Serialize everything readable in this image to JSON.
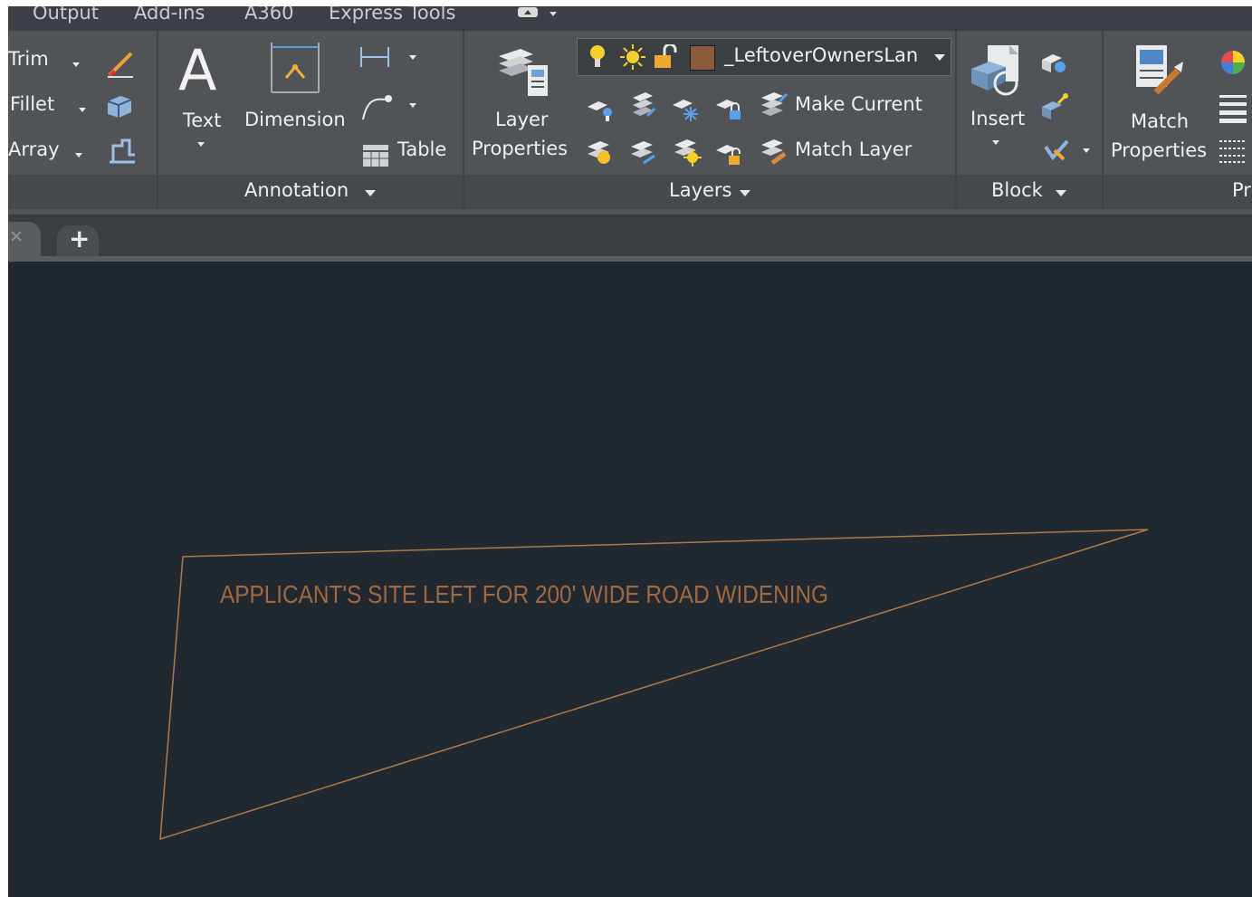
{
  "menu": {
    "tabs": [
      "Output",
      "Add-ins",
      "A360",
      "Express Tools"
    ]
  },
  "modify": {
    "trim": "Trim",
    "fillet": "Fillet",
    "array": "Array"
  },
  "annotation": {
    "text": "Text",
    "dimension": "Dimension",
    "table": "Table",
    "panel_title": "Annotation"
  },
  "layers": {
    "layer_properties_line1": "Layer",
    "layer_properties_line2": "Properties",
    "current_layer": "_LeftoverOwnersLan",
    "layer_color": "#8a5a3c",
    "make_current": "Make Current",
    "match_layer": "Match Layer",
    "panel_title": "Layers"
  },
  "block": {
    "insert": "Insert",
    "panel_title": "Block"
  },
  "properties": {
    "match_line1": "Match",
    "match_line2": "Properties",
    "panel_title_partial": "Pr"
  },
  "tabs": {
    "new_tab_symbol": "+"
  },
  "drawing": {
    "annotation_text": "APPLICANT'S SITE LEFT FOR 200' WIDE ROAD WIDENING",
    "line_color": "#b07a48",
    "background": "#212830"
  }
}
